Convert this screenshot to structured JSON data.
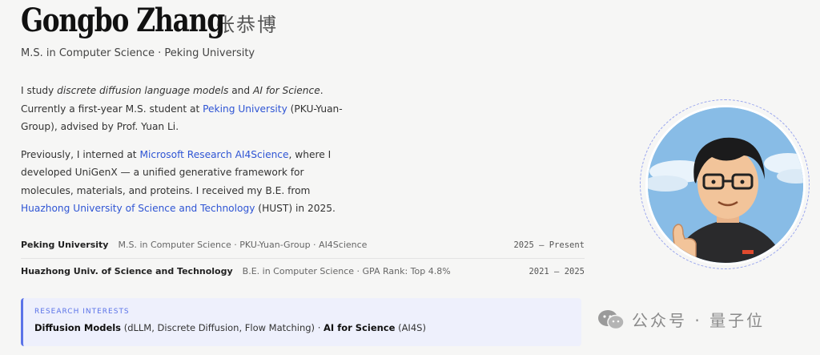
{
  "header": {
    "name": "Gongbo Zhang",
    "name_cn": "张恭博",
    "subtitle": "M.S. in Computer Science · Peking University"
  },
  "bio": {
    "p1": {
      "t1": "I study ",
      "em1": "discrete diffusion language models",
      "t2": " and ",
      "em2": "AI for Science",
      "t3": ". Currently a first-year M.S. student at ",
      "link1": "Peking University",
      "t4": " (PKU-Yuan-Group), advised by Prof. Yuan Li."
    },
    "p2": {
      "t1": "Previously, I interned at ",
      "link1": "Microsoft Research AI4Science",
      "t2": ", where I developed UniGenX — a unified generative framework for molecules, materials, and proteins. I received my B.E. from ",
      "link2": "Huazhong University of Science and Technology",
      "t3": " (HUST) in 2025."
    }
  },
  "education": [
    {
      "institution": "Peking University",
      "detail": "M.S. in Computer Science · PKU-Yuan-Group · AI4Science",
      "years": "2025 — Present"
    },
    {
      "institution": "Huazhong Univ. of Science and Technology",
      "detail": "B.E. in Computer Science · GPA Rank: Top 4.8%",
      "years": "2021 — 2025"
    }
  ],
  "interests": {
    "label": "RESEARCH INTERESTS",
    "item1_bold": "Diffusion Models",
    "item1_rest": " (dLLM, Discrete Diffusion, Flow Matching) · ",
    "item2_bold": "AI for Science",
    "item2_rest": " (AI4S)"
  },
  "watermark": {
    "text": "公众号 · 量子位",
    "icon": "wechat-icon"
  },
  "colors": {
    "link": "#2f55d4",
    "accent": "#5b73e8",
    "background": "#f6f6f5"
  }
}
